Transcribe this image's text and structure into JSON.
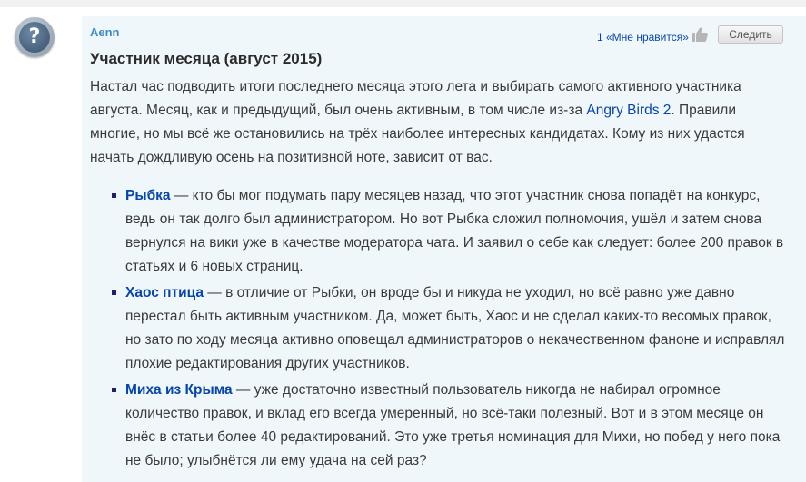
{
  "comment": {
    "author": "Aenn",
    "likes": "1 «Мне нравится»",
    "follow_label": "Следить",
    "title": "Участник месяца (август 2015)",
    "intro_before_link": "Настал час подводить итоги последнего месяца этого лета и выбирать самого активного участника августа. Месяц, как и предыдущий, был очень активным, в том числе из-за ",
    "intro_link": "Angry Birds 2",
    "intro_after_link": ". Правили многие, но мы всё же остановились на трёх наиболее интересных кандидатах. Кому из них удастся начать дождливую осень на позитивной ноте, зависит от вас."
  },
  "candidates": [
    {
      "name": "Рыбка",
      "text": " — кто бы мог подумать пару месяцев назад, что этот участник снова попадёт на конкурс, ведь он так долго был администратором. Но вот Рыбка сложил полномочия, ушёл и затем снова вернулся на вики уже в качестве модератора чата. И заявил о себе как следует: более 200 правок в статьях и 6 новых страниц."
    },
    {
      "name": "Хаос птица",
      "text": " — в отличие от Рыбки, он вроде бы и никуда не уходил, но всё равно уже давно перестал быть активным участником. Да, может быть, Хаос и не сделал каких-то весомых правок, но зато по ходу месяца активно оповещал администраторов о некачественном фаноне и исправлял плохие редактирования других участников."
    },
    {
      "name": "Миха из Крыма",
      "text": " — уже достаточно известный пользователь никогда не набирал огромное количество правок, и вклад его всегда умеренный, но всё-таки полезный. Вот и в этом месяце он внёс в статьи более 40 редактирований. Это уже третья номинация для Михи, но побед у него пока не было; улыбнётся ли ему удача на сей раз?"
    }
  ],
  "icons": {
    "avatar": "question-mark-avatar",
    "like": "thumbs-up-icon"
  },
  "colors": {
    "author": "#3a8bcc",
    "link": "#0645ad",
    "comment_background": "#f0f7fb"
  }
}
